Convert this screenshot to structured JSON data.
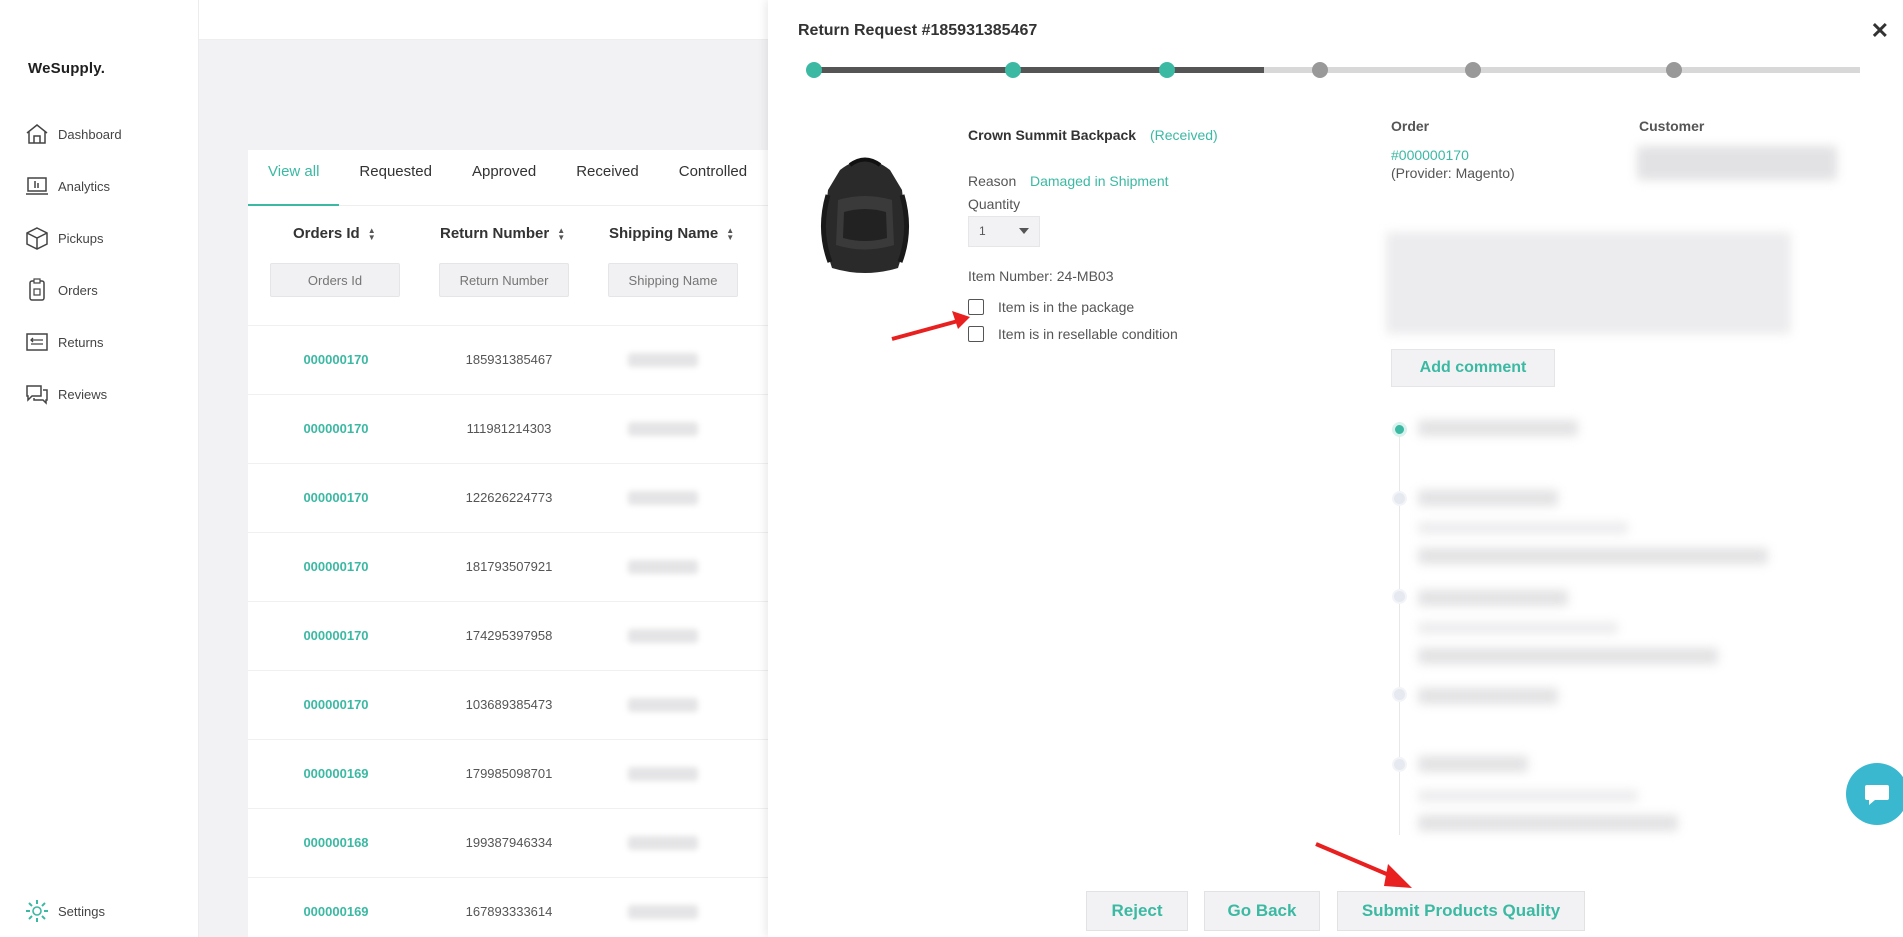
{
  "app": {
    "brand": "WeSupply."
  },
  "sidebar": {
    "items": [
      {
        "label": "Dashboard",
        "icon": "home-icon"
      },
      {
        "label": "Analytics",
        "icon": "analytics-icon"
      },
      {
        "label": "Pickups",
        "icon": "box-icon"
      },
      {
        "label": "Orders",
        "icon": "clipboard-icon"
      },
      {
        "label": "Returns",
        "icon": "returns-icon"
      },
      {
        "label": "Reviews",
        "icon": "chat-icon"
      }
    ],
    "settings_label": "Settings"
  },
  "tabs": [
    "View all",
    "Requested",
    "Approved",
    "Received",
    "Controlled"
  ],
  "table": {
    "columns": [
      "Orders Id",
      "Return Number",
      "Shipping Name"
    ],
    "filters": [
      "Orders Id",
      "Return Number",
      "Shipping Name"
    ],
    "rows": [
      {
        "order_id": "000000170",
        "return_number": "185931385467"
      },
      {
        "order_id": "000000170",
        "return_number": "111981214303"
      },
      {
        "order_id": "000000170",
        "return_number": "122626224773"
      },
      {
        "order_id": "000000170",
        "return_number": "181793507921"
      },
      {
        "order_id": "000000170",
        "return_number": "174295397958"
      },
      {
        "order_id": "000000170",
        "return_number": "103689385473"
      },
      {
        "order_id": "000000169",
        "return_number": "179985098701"
      },
      {
        "order_id": "000000168",
        "return_number": "199387946334"
      },
      {
        "order_id": "000000169",
        "return_number": "167893333614"
      }
    ]
  },
  "panel": {
    "title": "Return Request #185931385467",
    "close": "✕",
    "progress": {
      "steps": 6,
      "completed": 3
    },
    "product": {
      "name": "Crown Summit Backpack",
      "status": "(Received)",
      "reason_label": "Reason",
      "reason_value": "Damaged in Shipment",
      "quantity_label": "Quantity",
      "quantity_value": "1",
      "item_number": "Item Number: 24-MB03",
      "check_in_package": "Item is in the package",
      "check_resellable": "Item is in resellable condition"
    },
    "order": {
      "label": "Order",
      "link": "#000000170",
      "provider": "(Provider: Magento)"
    },
    "customer": {
      "label": "Customer"
    },
    "add_comment": "Add comment",
    "buttons": {
      "reject": "Reject",
      "go_back": "Go Back",
      "submit": "Submit Products Quality"
    }
  },
  "colors": {
    "accent": "#3bb9a3",
    "chat": "#3ab8cf",
    "arrow": "#e8201f"
  }
}
